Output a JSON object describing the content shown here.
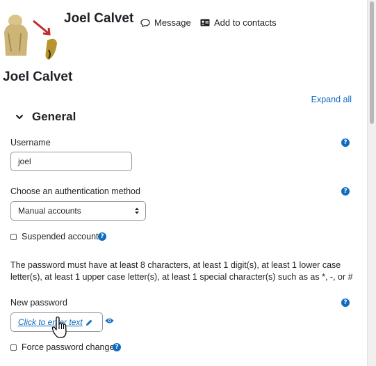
{
  "header": {
    "user_name": "Joel Calvet",
    "message_label": "Message",
    "add_contact_label": "Add to contacts"
  },
  "page": {
    "heading": "Joel Calvet",
    "expand_all": "Expand all"
  },
  "section": {
    "title": "General"
  },
  "form": {
    "username_label": "Username",
    "username_value": "joel",
    "auth_label": "Choose an authentication method",
    "auth_value": "Manual accounts",
    "suspended_label": "Suspended account",
    "password_policy": "The password must have at least 8 characters, at least 1 digit(s), at least 1 lower case letter(s), at least 1 upper case letter(s), at least 1 special character(s) such as as *, -, or #",
    "new_password_label": "New password",
    "password_placeholder": "Click to enter text",
    "force_change_label": "Force password change"
  },
  "colors": {
    "link": "#0f6cbf",
    "text": "#1d2125"
  }
}
